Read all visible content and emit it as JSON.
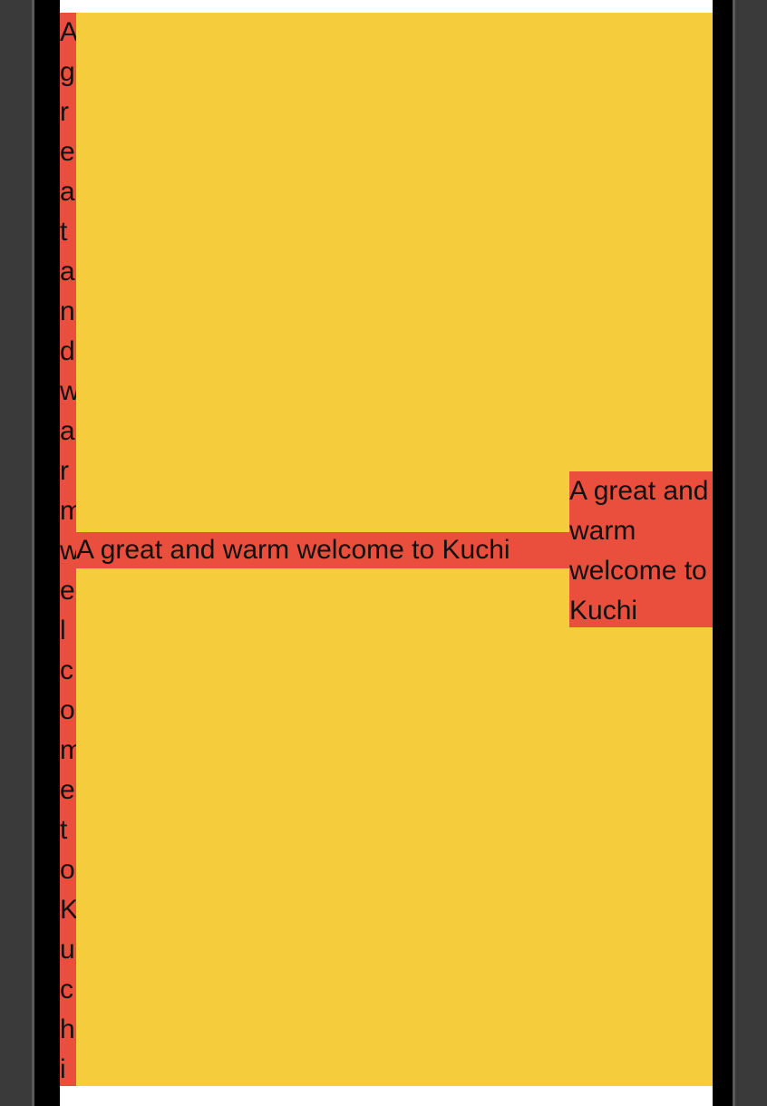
{
  "colors": {
    "background": "#F5CD3C",
    "label_background": "#E94F3C",
    "text": "#111111"
  },
  "labels": {
    "vertical_text": "A great and warm welcome to Kuchi",
    "horizontal_text": "A great and warm welcome to Kuchi",
    "wrapped_text": "A great and warm welcome to Kuchi"
  }
}
